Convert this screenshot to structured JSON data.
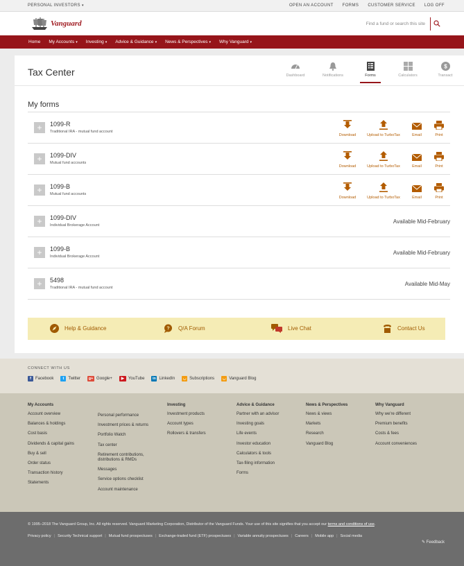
{
  "utility": {
    "personal_investors": "PERSONAL INVESTORS",
    "links": [
      "OPEN AN ACCOUNT",
      "FORMS",
      "CUSTOMER SERVICE",
      "LOG OFF"
    ]
  },
  "brand": {
    "name": "Vanguard",
    "search_placeholder": "Find a fund or search this site"
  },
  "nav": {
    "items": [
      {
        "label": "Home",
        "dropdown": false
      },
      {
        "label": "My Accounts",
        "dropdown": true
      },
      {
        "label": "Investing",
        "dropdown": true
      },
      {
        "label": "Advice & Guidance",
        "dropdown": true
      },
      {
        "label": "News & Perspectives",
        "dropdown": true
      },
      {
        "label": "Why Vanguard",
        "dropdown": true
      }
    ]
  },
  "page": {
    "title": "Tax Center",
    "tools": [
      {
        "label": "Dashboard",
        "icon": "gauge-icon"
      },
      {
        "label": "Notifications",
        "icon": "bell-icon"
      },
      {
        "label": "Forms",
        "icon": "document-list-icon",
        "active": true
      },
      {
        "label": "Calculators",
        "icon": "calculator-icon"
      },
      {
        "label": "Transact",
        "icon": "dollar-circle-icon"
      }
    ]
  },
  "forms": {
    "title": "My forms",
    "action_labels": {
      "download": "Download",
      "upload": "Upload to TurboTax",
      "email": "Email",
      "print": "Print"
    },
    "rows": [
      {
        "name": "1099-R",
        "desc": "Traditional IRA - mutual fund account",
        "status": ""
      },
      {
        "name": "1099-DIV",
        "desc": "Mutual fund accounts",
        "status": ""
      },
      {
        "name": "1099-B",
        "desc": "Mutual fund accounts",
        "status": ""
      },
      {
        "name": "1099-DIV",
        "desc": "Individual Brokerage Account",
        "status": "Available Mid-February"
      },
      {
        "name": "1099-B",
        "desc": "Individual Brokerage Account",
        "status": "Available Mid-February"
      },
      {
        "name": "5498",
        "desc": "Traditional IRA - mutual fund account",
        "status": "Available Mid-May"
      }
    ]
  },
  "support": {
    "help": "Help & Guidance",
    "forum": "Q/A Forum",
    "chat": "Live Chat",
    "contact": "Contact Us"
  },
  "connect": {
    "title": "CONNECT WITH US",
    "items": [
      "Facebook",
      "Twitter",
      "Google+",
      "YouTube",
      "LinkedIn",
      "Subscriptions",
      "Vanguard Blog"
    ],
    "colors": {
      "facebook": "#3b5998",
      "twitter": "#1da1f2",
      "google": "#dd4b39",
      "youtube": "#cc181e",
      "linkedin": "#0077b5",
      "rss": "#f39c12"
    }
  },
  "footer": {
    "col1": {
      "heading": "My Accounts",
      "links": [
        "Account overview",
        "Balances & holdings",
        "Cost basis",
        "Dividends & capital gains",
        "Buy & sell",
        "Order status",
        "Transaction history",
        "Statements"
      ]
    },
    "col2": {
      "links": [
        "Personal performance",
        "Investment prices & returns",
        "Portfolio Watch",
        "Tax center",
        "Retirement contributions, distributions & RMDs",
        "Messages",
        "Service options checklist",
        "Account maintenance"
      ]
    },
    "col3": {
      "heading": "Investing",
      "links": [
        "Investment products",
        "Account types",
        "Rollovers & transfers"
      ]
    },
    "col4": {
      "heading": "Advice & Guidance",
      "links": [
        "Partner with an advisor",
        "Investing goals",
        "Life events",
        "Investor education",
        "Calculators & tools",
        "Tax-filing information",
        "Forms"
      ]
    },
    "col5": {
      "heading": "News & Perspectives",
      "links": [
        "News & views",
        "Markets",
        "Research",
        "Vanguard Blog"
      ]
    },
    "col6": {
      "heading": "Why Vanguard",
      "links": [
        "Why we're different",
        "Premium benefits",
        "Costs & fees",
        "Account conveniences"
      ]
    }
  },
  "legal": {
    "copyright": "© 1995–2018 The Vanguard Group, Inc. All rights reserved. Vanguard Marketing Corporation, Distributor of the Vanguard Funds. Your use of this site signifies that you accept our ",
    "terms": "terms and conditions of use",
    "period": ".",
    "links": [
      "Privacy policy",
      "Security",
      "Technical support",
      "Mutual fund prospectuses",
      "Exchange-traded fund (ETF) prospectuses",
      "Variable annuity prospectuses",
      "Careers",
      "Mobile app",
      "Social media"
    ],
    "feedback": "Feedback"
  },
  "accent": "#96151a",
  "action_color": "#b35c00"
}
